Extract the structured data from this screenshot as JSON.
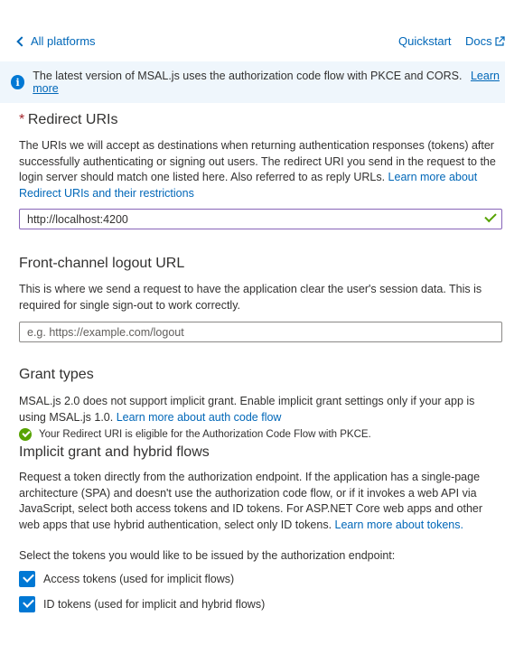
{
  "nav": {
    "back_label": "All platforms",
    "quickstart_label": "Quickstart",
    "docs_label": "Docs"
  },
  "banner": {
    "text": "The latest version of MSAL.js uses the authorization code flow with PKCE and CORS.",
    "link": "Learn more"
  },
  "redirect": {
    "required_mark": "*",
    "heading": "Redirect URIs",
    "description": "The URIs we will accept as destinations when returning authentication responses (tokens) after successfully authenticating or signing out users. The redirect URI you send in the request to the login server should match one listed here. Also referred to as reply URLs.",
    "link": "Learn more about Redirect URIs and their restrictions",
    "value": "http://localhost:4200"
  },
  "logout": {
    "heading": "Front-channel logout URL",
    "description": "This is where we send a request to have the application clear the user's session data. This is required for single sign-out to work correctly.",
    "placeholder": "e.g. https://example.com/logout"
  },
  "grant": {
    "heading": "Grant types",
    "description": "MSAL.js 2.0 does not support implicit grant. Enable implicit grant settings only if your app is using MSAL.js 1.0.",
    "link": "Learn more about auth code flow",
    "eligible": "Your Redirect URI is eligible for the Authorization Code Flow with PKCE."
  },
  "implicit": {
    "heading": "Implicit grant and hybrid flows",
    "description": "Request a token directly from the authorization endpoint. If the application has a single-page architecture (SPA) and doesn't use the authorization code flow, or if it invokes a web API via JavaScript, select both access tokens and ID tokens. For ASP.NET Core web apps and other web apps that use hybrid authentication, select only ID tokens.",
    "link": "Learn more about tokens.",
    "select_prompt": "Select the tokens you would like to be issued by the authorization endpoint:",
    "access_tokens_label": "Access tokens (used for implicit flows)",
    "id_tokens_label": "ID tokens (used for implicit and hybrid flows)",
    "access_tokens_checked": true,
    "id_tokens_checked": true
  },
  "colors": {
    "link": "#0067b8",
    "banner_bg": "#eff6fc",
    "info_icon": "#0078d4",
    "success": "#57a300",
    "checkbox": "#0078d4",
    "required": "#a4262c"
  }
}
